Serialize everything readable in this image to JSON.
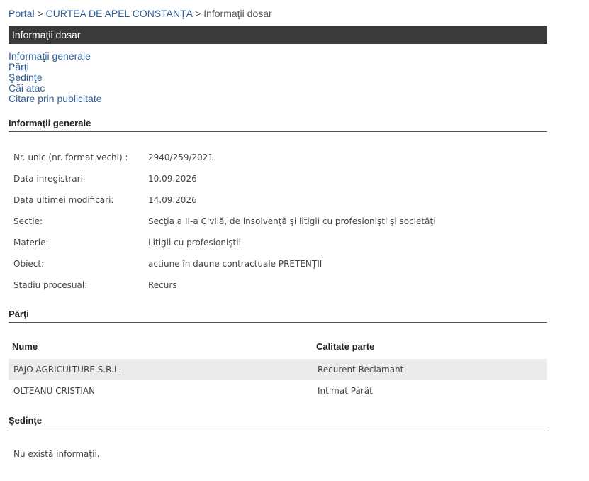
{
  "breadcrumb": {
    "portal": "Portal",
    "court": "CURTEA DE APEL CONSTANŢA",
    "current": "Informaţii dosar",
    "separator": ">"
  },
  "title": "Informaţii dosar",
  "toc": [
    "Informaţii generale",
    "Părţi",
    "Şedinţe",
    "Căi atac",
    "Citare prin publicitate"
  ],
  "general": {
    "heading": "Informaţii generale",
    "rows": [
      {
        "label": "Nr. unic (nr. format vechi) :",
        "value": "2940/259/2021"
      },
      {
        "label": "Data inregistrarii",
        "value": "10.09.2026"
      },
      {
        "label": "Data ultimei modificari:",
        "value": "14.09.2026"
      },
      {
        "label": "Sectie:",
        "value": "Secţia a II-a Civilă, de insolvenţă şi litigii cu profesionişti şi societăţi"
      },
      {
        "label": "Materie:",
        "value": "Litigii cu profesioniştii"
      },
      {
        "label": "Obiect:",
        "value": "actiune în daune contractuale PRETENŢII"
      },
      {
        "label": "Stadiu procesual:",
        "value": "Recurs"
      }
    ]
  },
  "parties": {
    "heading": "Părţi",
    "col_name": "Nume",
    "col_role": "Calitate parte",
    "rows": [
      {
        "name": "PAJO AGRICULTURE S.R.L.",
        "role": "Recurent Reclamant"
      },
      {
        "name": "OLTEANU CRISTIAN",
        "role": "Intimat Pârât"
      }
    ]
  },
  "hearings": {
    "heading": "Şedinţe",
    "empty": "Nu există informaţii."
  }
}
